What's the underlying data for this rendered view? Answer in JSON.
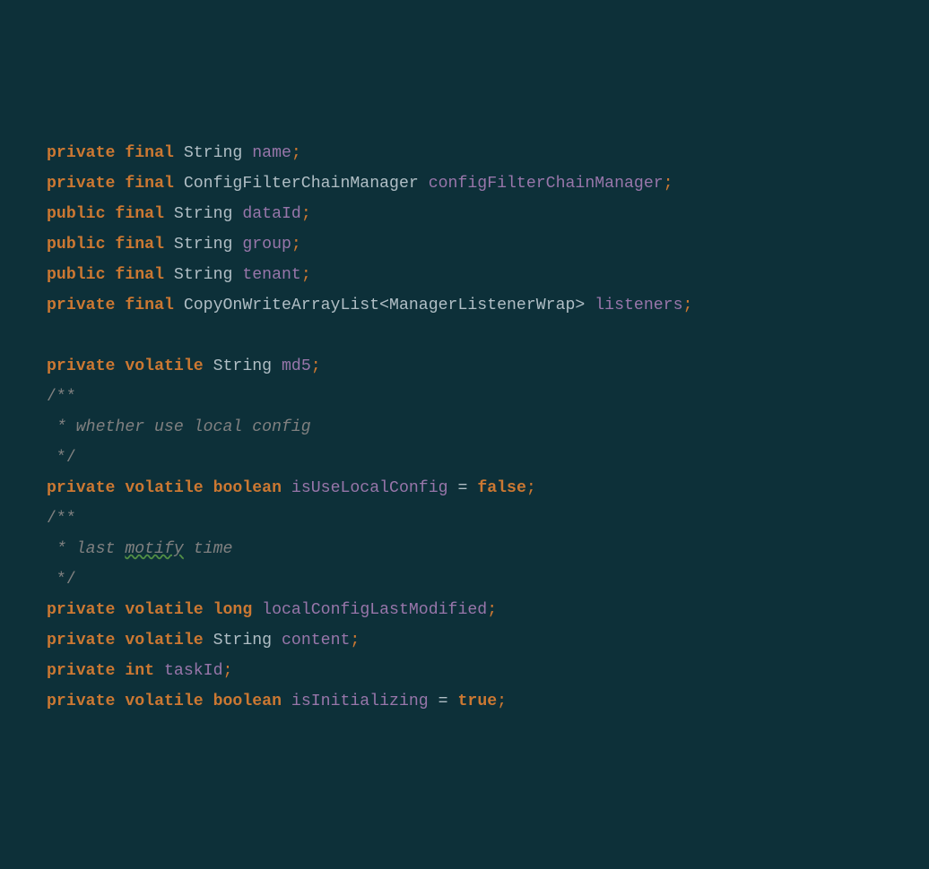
{
  "code": {
    "kw_private": "private",
    "kw_public": "public",
    "kw_final": "final",
    "kw_volatile": "volatile",
    "kw_int": "int",
    "kw_long": "long",
    "kw_boolean": "boolean",
    "kw_true": "true",
    "kw_false": "false",
    "type_string": "String",
    "type_cfcm": "ConfigFilterChainManager",
    "type_cowal": "CopyOnWriteArrayList",
    "type_mlw": "ManagerListenerWrap",
    "field_name": "name",
    "field_cfcm": "configFilterChainManager",
    "field_dataId": "dataId",
    "field_group": "group",
    "field_tenant": "tenant",
    "field_listeners": "listeners",
    "field_md5": "md5",
    "field_isUseLocalConfig": "isUseLocalConfig",
    "field_localConfigLastModified": "localConfigLastModified",
    "field_content": "content",
    "field_taskId": "taskId",
    "field_isInitializing": "isInitializing",
    "comment1_open": "/**",
    "comment1_body": " * whether use local config",
    "comment1_close": " */",
    "comment2_open": "/**",
    "comment2_body_prefix": " * last ",
    "comment2_typo": "motify",
    "comment2_body_suffix": " time",
    "comment2_close": " */",
    "lt": "<",
    "gt": ">",
    "semi": ";",
    "eq": "=",
    "space": " "
  }
}
